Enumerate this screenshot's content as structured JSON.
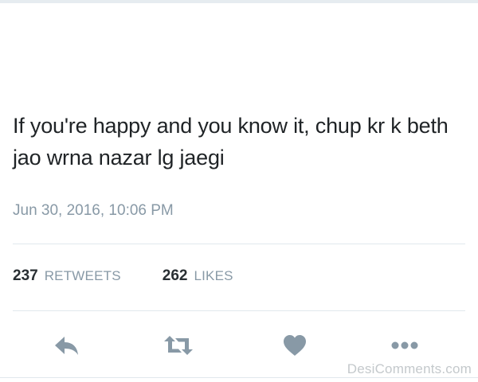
{
  "tweet": {
    "text": "If you're happy and you know it, chup kr k beth jao wrna nazar lg jaegi",
    "timestamp": "Jun 30, 2016, 10:06 PM"
  },
  "stats": {
    "retweets": {
      "count": "237",
      "label": "RETWEETS"
    },
    "likes": {
      "count": "262",
      "label": "LIKES"
    }
  },
  "actions": {
    "reply": {
      "icon": "reply-icon"
    },
    "retweet": {
      "icon": "retweet-icon"
    },
    "like": {
      "icon": "heart-icon"
    },
    "more": {
      "icon": "more-icon"
    }
  },
  "watermark": "DesiComments.com",
  "colors": {
    "text": "#1f2326",
    "muted": "#8899a6",
    "icon": "#8899a6",
    "divider": "#e1e8ed"
  }
}
